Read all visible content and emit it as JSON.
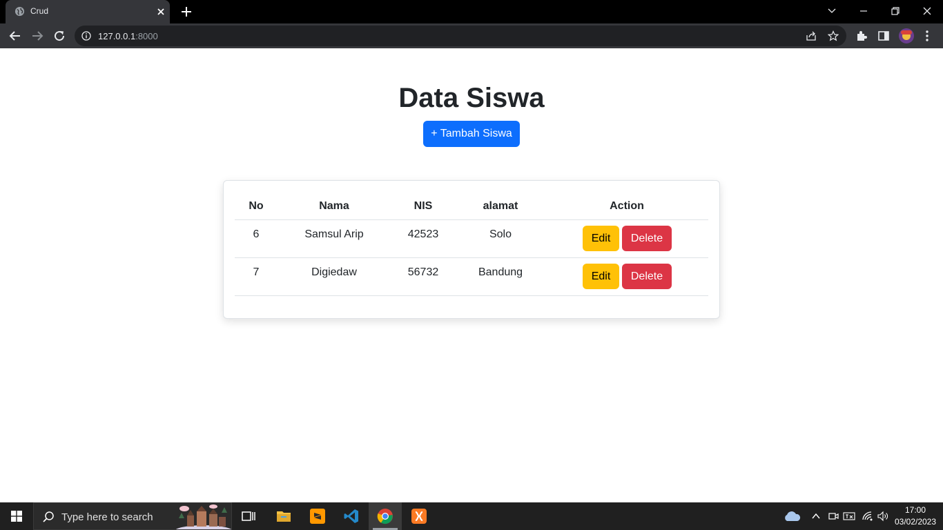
{
  "browser": {
    "tab_title": "Crud",
    "url_host": "127.0.0.1",
    "url_port": ":8000"
  },
  "page": {
    "title": "Data Siswa",
    "add_button": "+ Tambah Siswa"
  },
  "table": {
    "headers": [
      "No",
      "Nama",
      "NIS",
      "alamat",
      "Action"
    ],
    "rows": [
      {
        "no": "6",
        "nama": "Samsul Arip",
        "nis": "42523",
        "alamat": "Solo",
        "edit": "Edit",
        "delete": "Delete"
      },
      {
        "no": "7",
        "nama": "Digiedaw",
        "nis": "56732",
        "alamat": "Bandung",
        "edit": "Edit",
        "delete": "Delete"
      }
    ]
  },
  "taskbar": {
    "search_placeholder": "Type here to search",
    "time": "17:00",
    "date": "03/02/2023"
  },
  "colors": {
    "primary": "#0d6efd",
    "warning": "#ffc107",
    "danger": "#dc3545",
    "chrome_dark": "#35363a"
  }
}
